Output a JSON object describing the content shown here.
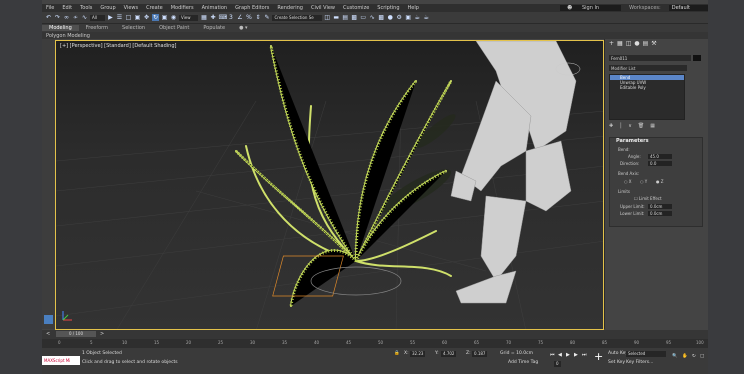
{
  "menu": [
    "File",
    "Edit",
    "Tools",
    "Group",
    "Views",
    "Create",
    "Modifiers",
    "Animation",
    "Graph Editors",
    "Rendering",
    "Civil View",
    "Customize",
    "Scripting",
    "Help"
  ],
  "signin": {
    "label": "Sign In",
    "workspaces_label": "Workspaces:",
    "workspace_value": "Default"
  },
  "toolbar": {
    "filter_value": "All",
    "view_value": "View",
    "selection_set": "Create Selection Se"
  },
  "ribbon": {
    "tabs": [
      "Modeling",
      "Freeform",
      "Selection",
      "Object Paint",
      "Populate"
    ],
    "sub": "Polygon Modeling"
  },
  "viewport": {
    "label": "[+] [Perspective] [Standard] [Default Shading]"
  },
  "command_panel": {
    "object_name": "Fern011",
    "modifier_list": "Modifier List",
    "stack": [
      "Bend",
      "Unwrap UVW",
      "Editable Poly"
    ],
    "parameters_title": "Parameters",
    "bend_label": "Bend:",
    "angle_label": "Angle:",
    "angle_value": "45.0",
    "direction_label": "Direction:",
    "direction_value": "0.0",
    "bend_axis_label": "Bend Axis:",
    "axes": [
      "X",
      "Y",
      "Z"
    ],
    "limits_label": "Limits",
    "limit_effect": "Limit Effect",
    "upper_label": "Upper Limit:",
    "upper_value": "0.0cm",
    "lower_label": "Lower Limit:",
    "lower_value": "0.0cm"
  },
  "timeline": {
    "slider": "0 / 100",
    "ticks": [
      "0",
      "5",
      "10",
      "15",
      "20",
      "25",
      "30",
      "35",
      "40",
      "45",
      "50",
      "55",
      "60",
      "65",
      "70",
      "75",
      "80",
      "85",
      "90",
      "95",
      "100"
    ]
  },
  "status": {
    "maxscript": "MAXScript Mi",
    "selected": "1 Object Selected",
    "prompt": "Click and drag to select and rotate objects",
    "x_label": "X:",
    "x_value": "32.23",
    "y_label": "Y:",
    "y_value": "4.702",
    "z_label": "Z:",
    "z_value": "0.187",
    "grid": "Grid = 10.0cm",
    "add_time_tag": "Add Time Tag",
    "auto_key": "Auto Key",
    "set_key": "Set Key",
    "selected_dd": "Selected",
    "key_filters": "Key Filters...",
    "frame": "0"
  }
}
